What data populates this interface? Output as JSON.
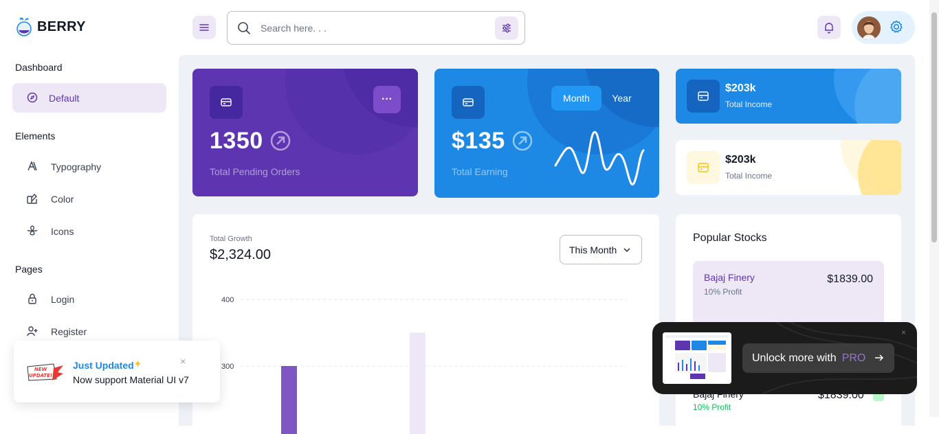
{
  "brand": {
    "name": "BERRY"
  },
  "search": {
    "placeholder": "Search here. . ."
  },
  "sidebar": {
    "sections": [
      {
        "title": "Dashboard",
        "items": [
          {
            "label": "Default",
            "icon": "dashboard-icon",
            "active": true
          }
        ]
      },
      {
        "title": "Elements",
        "items": [
          {
            "label": "Typography",
            "icon": "typography-icon"
          },
          {
            "label": "Color",
            "icon": "palette-icon"
          },
          {
            "label": "Icons",
            "icon": "windmill-icon"
          }
        ]
      },
      {
        "title": "Pages",
        "items": [
          {
            "label": "Login",
            "icon": "lock-icon"
          },
          {
            "label": "Register",
            "icon": "user-plus-icon"
          }
        ]
      }
    ]
  },
  "cards": {
    "pending": {
      "value": "1350",
      "label": "Total Pending Orders"
    },
    "earning": {
      "value": "$135",
      "label": "Total Earning",
      "toggle_month": "Month",
      "toggle_year": "Year"
    },
    "income_primary": {
      "value": "$203k",
      "label": "Total Income"
    },
    "income_secondary": {
      "value": "$203k",
      "label": "Total Income"
    }
  },
  "growth": {
    "label": "Total Growth",
    "value": "$2,324.00",
    "period_select": "This Month"
  },
  "chart_data": {
    "type": "bar",
    "ylim": [
      0,
      400
    ],
    "yticks": [
      "400",
      "300"
    ],
    "grid": true,
    "series": [
      {
        "values": [
          300
        ]
      },
      {
        "values": [
          350
        ]
      }
    ]
  },
  "stocks": {
    "title": "Popular Stocks",
    "featured": {
      "name": "Bajaj Finery",
      "profit": "10% Profit",
      "price": "$1839.00"
    },
    "rows": [
      {
        "name": "Bajaj Finery",
        "profit": "10% Profit",
        "price": "$1839.00"
      }
    ]
  },
  "toast": {
    "badge_line1": "NEW",
    "badge_line2": "UPDATE!",
    "title": "Just Updated",
    "message": "Now support Material UI v7",
    "close": "×"
  },
  "promo": {
    "text": "Unlock more with",
    "highlight": "PRO",
    "close": "×"
  },
  "colors": {
    "primary": "#5e35b1",
    "secondary": "#1e88e5",
    "primary_light": "#ede7f6",
    "warning_light": "#fff8e1"
  }
}
